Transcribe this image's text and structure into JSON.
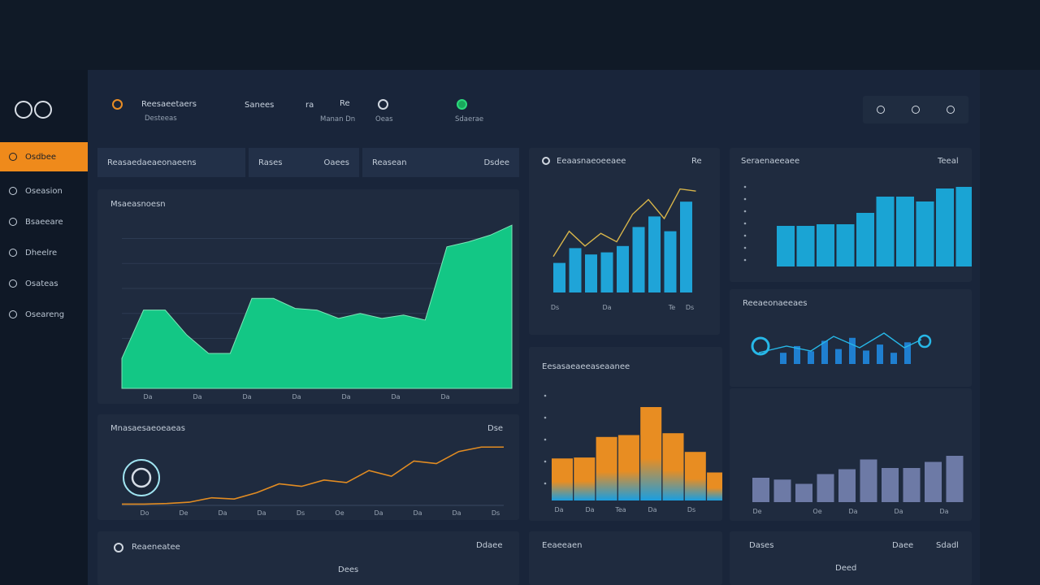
{
  "app": {
    "logo_text": "ꝏ"
  },
  "sidebar": {
    "items": [
      {
        "label": "Osdbee",
        "active": true
      },
      {
        "label": "Oseasion",
        "active": false
      },
      {
        "label": "Bsaeeare",
        "active": false
      },
      {
        "label": "Dheelre",
        "active": false
      },
      {
        "label": "Osateas",
        "active": false
      },
      {
        "label": "Oseareng",
        "active": false
      }
    ]
  },
  "header": {
    "title": "Reesaeetaers",
    "subtitle": "Desteeas",
    "item2_label": "Sanees",
    "item3_label": "ra",
    "item3_value": "Re",
    "item3_sub": "Manan Dn",
    "item4_sub": "Oeas",
    "item5_sub": "Sdaerae",
    "accent_green": "#2bd97c",
    "accent_orange": "#ef8a1b"
  },
  "toolbar": {
    "search_label": "Reasaedaeaeonaeens",
    "tab1": "Rases",
    "tab2": "Oaees",
    "tab3": "Reasean",
    "tab4": "Dsdee"
  },
  "panels": {
    "area_chart": {
      "title": "Msaeasnoesn"
    },
    "line_chart": {
      "title": "Mnasaesaeoeaeas",
      "action": "Dse"
    },
    "mini_bar_chart": {
      "title": "Eeaasnaeoeeaee",
      "action": "Re"
    },
    "right_bar_chart": {
      "title": "Seraenaeeaee",
      "action": "Teeal"
    },
    "sparkline": {
      "title": "Reeaeonaeeaes"
    },
    "gradient_bar_chart": {
      "title": "Eesasaeaeeaseaanee"
    },
    "purple_bar_chart": {
      "title": ""
    },
    "bottom_left": {
      "title": "Reaeneatee",
      "action": "Ddaee",
      "value": "Dees"
    },
    "bottom_middle": {
      "title": "Eeaeeaen"
    },
    "bottom_right": {
      "title": "Dases",
      "action": "Sdadl",
      "value": "Deed",
      "extra": "Daee"
    }
  },
  "chart_data": [
    {
      "id": "area",
      "type": "area",
      "color": "#13c785",
      "x": [
        "Da",
        "Da",
        "Da",
        "Da",
        "Da",
        "Da",
        "Da"
      ],
      "values": [
        18,
        47,
        47,
        32,
        21,
        21,
        54,
        54,
        48,
        47,
        42,
        45,
        42,
        44,
        41,
        85,
        88,
        92,
        98
      ],
      "ylim": [
        0,
        100
      ]
    },
    {
      "id": "line",
      "type": "line",
      "color": "#e28c22",
      "x": [
        "Do",
        "De",
        "Da",
        "Da",
        "Ds",
        "Oe",
        "Da",
        "Da",
        "Da",
        "Ds"
      ],
      "values": [
        2,
        2,
        3,
        5,
        12,
        10,
        20,
        34,
        30,
        40,
        36,
        55,
        46,
        70,
        66,
        85,
        92,
        92
      ],
      "ylim": [
        0,
        100
      ]
    },
    {
      "id": "mini-bar",
      "type": "bar",
      "bar_color": "#1fa4d8",
      "line_color": "#d8b54a",
      "values": [
        28,
        42,
        36,
        38,
        44,
        62,
        72,
        58,
        86
      ],
      "line_values": [
        34,
        58,
        44,
        56,
        48,
        74,
        88,
        70,
        98,
        96
      ],
      "x": [
        "Ds",
        "Da",
        "Te",
        "Ds"
      ],
      "ylim": [
        0,
        100
      ]
    },
    {
      "id": "right-bar",
      "type": "bar",
      "bar_color": "#1aa4d4",
      "values": [
        50,
        50,
        52,
        52,
        66,
        86,
        86,
        80,
        96,
        98
      ],
      "ylim": [
        0,
        100
      ]
    },
    {
      "id": "sparkline",
      "type": "bar",
      "bar_color": "#1f7fd0",
      "values": [
        30,
        48,
        34,
        62,
        40,
        70,
        36,
        52,
        30,
        58
      ],
      "ylim": [
        0,
        100
      ]
    },
    {
      "id": "gradient-bar",
      "type": "bar",
      "top_color": "#e88d22",
      "bottom_color": "#1a9ee0",
      "values": [
        45,
        46,
        68,
        70,
        100,
        72,
        52,
        30
      ],
      "x": [
        "Da",
        "Da",
        "Tea",
        "Da",
        "Ds"
      ],
      "ylim": [
        0,
        100
      ]
    },
    {
      "id": "purple-bar",
      "type": "bar",
      "bar_color": "#6d7aa6",
      "values": [
        40,
        37,
        30,
        46,
        54,
        70,
        56,
        56,
        66,
        76
      ],
      "x": [
        "De",
        "Oe",
        "Da",
        "Da",
        "Da"
      ],
      "ylim": [
        0,
        100
      ]
    }
  ]
}
